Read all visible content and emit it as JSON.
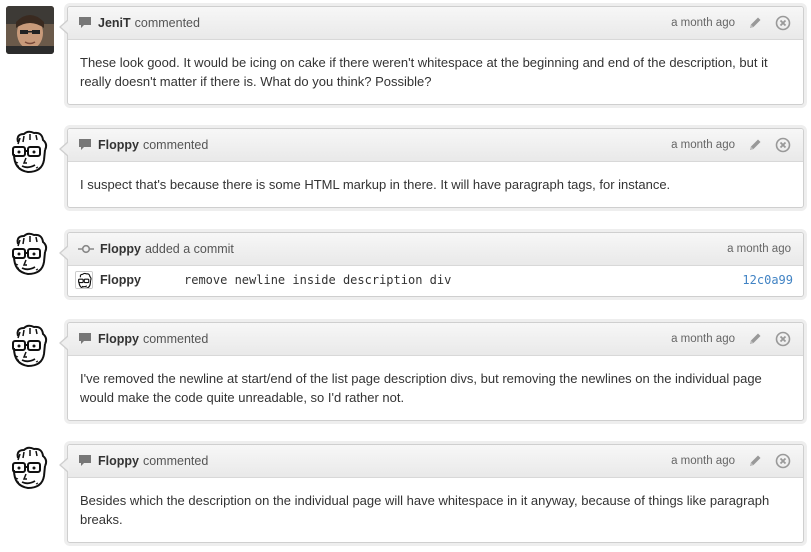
{
  "timeline": [
    {
      "kind": "comment",
      "author": "JeniT",
      "action": "commented",
      "time": "a month ago",
      "body": "These look good. It would be icing on cake if there weren't whitespace at the beginning and end of the description, but it really doesn't matter if there is. What do you think? Possible?"
    },
    {
      "kind": "comment",
      "author": "Floppy",
      "action": "commented",
      "time": "a month ago",
      "body": "I suspect that's because there is some HTML markup in there. It will have paragraph tags, for instance."
    },
    {
      "kind": "commit",
      "author": "Floppy",
      "action": "added a commit",
      "time": "a month ago",
      "commit": {
        "author": "Floppy",
        "message": "remove newline inside description div",
        "sha": "12c0a99"
      }
    },
    {
      "kind": "comment",
      "author": "Floppy",
      "action": "commented",
      "time": "a month ago",
      "body": "I've removed the newline at start/end of the list page description divs, but removing the newlines on the individual page would make the code quite unreadable, so I'd rather not."
    },
    {
      "kind": "comment",
      "author": "Floppy",
      "action": "commented",
      "time": "a month ago",
      "body": "Besides which the description on the individual page will have whitespace in it anyway, because of things like paragraph breaks."
    }
  ],
  "icons": {
    "comment": "speech-bubble-icon",
    "commit": "git-commit-icon",
    "edit": "pencil-icon",
    "delete": "close-circle-icon"
  },
  "colors": {
    "sha_link": "#4183c4",
    "header_bg": "#efefef",
    "border": "#cfcfcf"
  }
}
